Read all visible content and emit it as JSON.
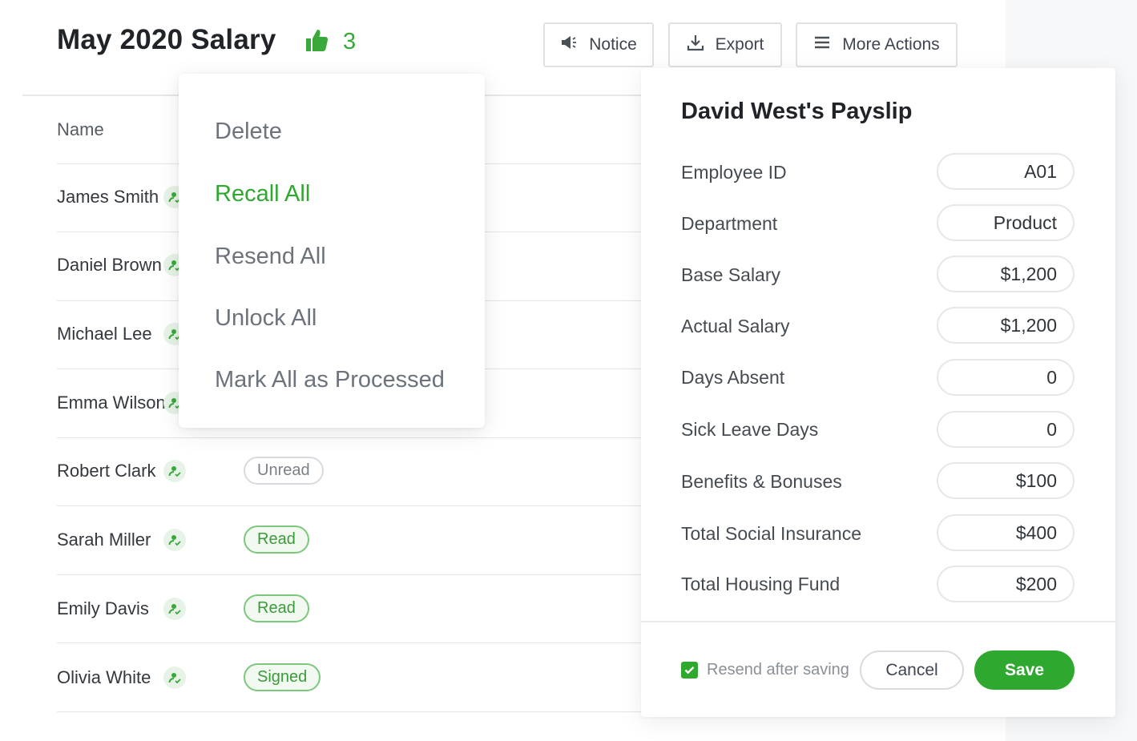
{
  "header": {
    "title": "May 2020 Salary",
    "likes_count": "3",
    "buttons": {
      "notice": "Notice",
      "export": "Export",
      "more_actions": "More Actions"
    }
  },
  "table": {
    "column_name": "Name",
    "rows": [
      {
        "name": "James Smith",
        "status": ""
      },
      {
        "name": "Daniel Brown",
        "status": ""
      },
      {
        "name": "Michael Lee",
        "status": ""
      },
      {
        "name": "Emma Wilson",
        "status": ""
      },
      {
        "name": "Robert Clark",
        "status": "Unread"
      },
      {
        "name": "Sarah Miller",
        "status": "Read"
      },
      {
        "name": "Emily Davis",
        "status": "Read"
      },
      {
        "name": "Olivia White",
        "status": "Signed"
      }
    ]
  },
  "menu": {
    "items": [
      "Delete",
      "Recall All",
      "Resend All",
      "Unlock All",
      "Mark All as Processed"
    ],
    "active_item": "Recall All"
  },
  "payslip": {
    "title": "David West's Payslip",
    "fields": [
      {
        "label": "Employee ID",
        "value": "A01"
      },
      {
        "label": "Department",
        "value": "Product"
      },
      {
        "label": "Base Salary",
        "value": "$1,200"
      },
      {
        "label": "Actual Salary",
        "value": "$1,200"
      },
      {
        "label": "Days Absent",
        "value": "0"
      },
      {
        "label": "Sick Leave Days",
        "value": "0"
      },
      {
        "label": "Benefits & Bonuses",
        "value": "$100"
      },
      {
        "label": "Total Social Insurance",
        "value": "$400"
      },
      {
        "label": "Total Housing Fund",
        "value": "$200"
      }
    ],
    "resend_label": "Resend after saving",
    "resend_checked": true,
    "cancel_label": "Cancel",
    "save_label": "Save"
  },
  "colors": {
    "accent": "#2fa82f",
    "text": "#2b2f33",
    "muted": "#6c737c"
  },
  "icons": {
    "likes": "thumbs-up-icon",
    "notice": "megaphone-icon",
    "export": "download-icon",
    "more_actions": "menu-icon",
    "row_user": "user-check-icon",
    "checkbox": "check-icon"
  }
}
